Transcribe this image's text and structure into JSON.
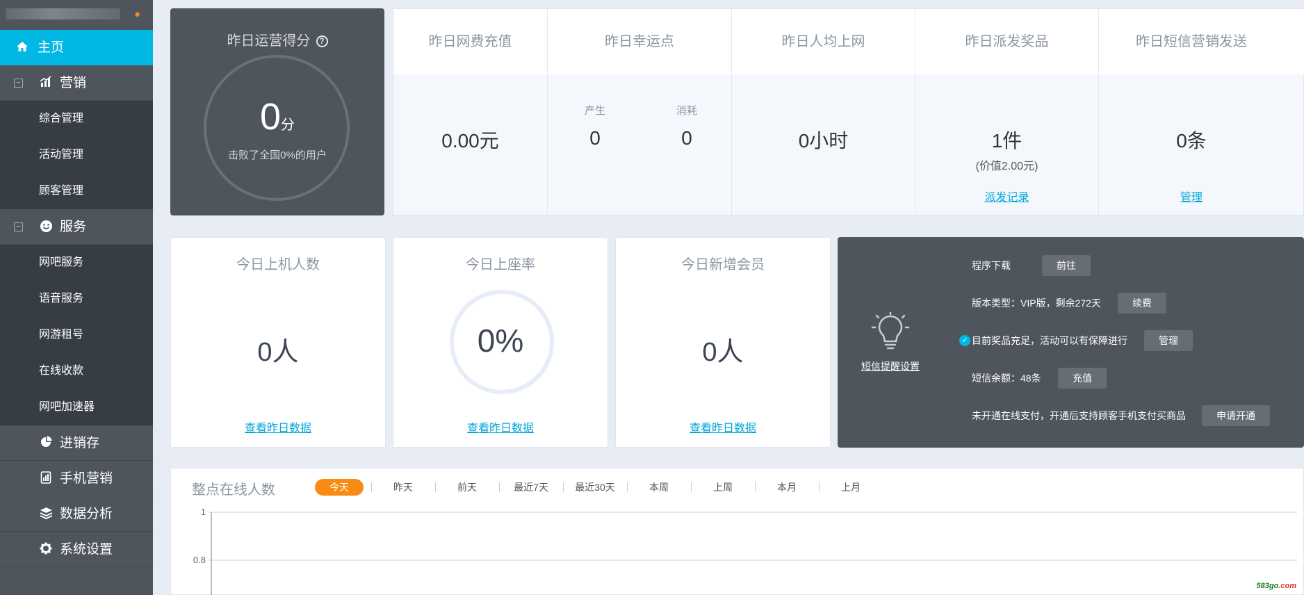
{
  "sidebar": {
    "items": [
      {
        "label": "主页",
        "icon": "home-icon"
      },
      {
        "label": "营销",
        "icon": "chart-icon",
        "toggle": "−",
        "children": [
          "综合管理",
          "活动管理",
          "顾客管理"
        ]
      },
      {
        "label": "服务",
        "icon": "smiley-icon",
        "toggle": "−",
        "children": [
          "网吧服务",
          "语音服务",
          "网游租号",
          "在线收款",
          "网吧加速器"
        ]
      },
      {
        "label": "进销存",
        "icon": "pie-icon"
      },
      {
        "label": "手机营销",
        "icon": "phone-chart-icon"
      },
      {
        "label": "数据分析",
        "icon": "layers-icon"
      },
      {
        "label": "系统设置",
        "icon": "gear-icon"
      }
    ]
  },
  "score": {
    "title": "昨日运营得分",
    "value": "0",
    "unit": "分",
    "beat": "击败了全国0%的用户"
  },
  "stats": [
    {
      "title": "昨日网费充值",
      "value": "0.00元"
    },
    {
      "title": "昨日幸运点",
      "produce_label": "产生",
      "produce_value": "0",
      "consume_label": "消耗",
      "consume_value": "0"
    },
    {
      "title": "昨日人均上网",
      "value": "0小时"
    },
    {
      "title": "昨日派发奖品",
      "value": "1件",
      "sub": "(价值2.00元)",
      "link": "派发记录"
    },
    {
      "title": "昨日短信营销发送",
      "value": "0条",
      "link": "管理"
    }
  ],
  "today": [
    {
      "title": "今日上机人数",
      "value": "0人",
      "link": "查看昨日数据"
    },
    {
      "title": "今日上座率",
      "value": "0%",
      "link": "查看昨日数据"
    },
    {
      "title": "今日新增会员",
      "value": "0人",
      "link": "查看昨日数据"
    }
  ],
  "info": {
    "sms_setting": "短信提醒设置",
    "rows": [
      {
        "text": "程序下载",
        "button": "前往"
      },
      {
        "text": "版本类型：VIP版，剩余272天",
        "button": "续费"
      },
      {
        "text": "目前奖品充足，活动可以有保障进行",
        "button": "管理"
      },
      {
        "text": "短信余额：48条",
        "button": "充值"
      },
      {
        "text": "未开通在线支付，开通后支持顾客手机支付买商品",
        "button": "申请开通"
      }
    ]
  },
  "chart": {
    "title": "整点在线人数",
    "tabs": [
      "今天",
      "昨天",
      "前天",
      "最近7天",
      "最近30天",
      "本周",
      "上周",
      "本月",
      "上月"
    ],
    "active_tab": "今天",
    "accent": "#f88b14"
  },
  "chart_data": {
    "type": "line",
    "title": "整点在线人数",
    "yticks": [
      "1",
      "0.8"
    ],
    "ylim": [
      0.8,
      1
    ],
    "series": [],
    "grid": true
  },
  "watermark": {
    "prefix": "583go",
    "suffix": ".com"
  }
}
